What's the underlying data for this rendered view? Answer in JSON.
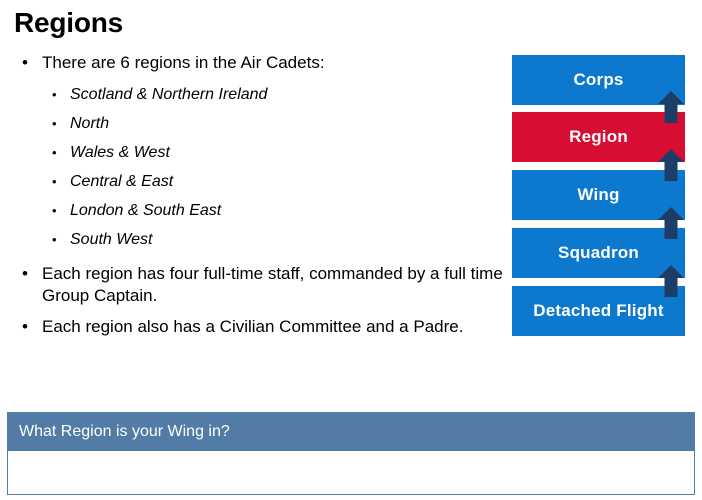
{
  "slide": {
    "title": "Regions"
  },
  "content": {
    "bullets": [
      {
        "text": "There are 6 regions in the Air Cadets:",
        "marker": "•",
        "sub_marker": "•",
        "sub_items": [
          "Scotland & Northern Ireland",
          "North",
          "Wales & West",
          "Central & East",
          "London & South East",
          "South West"
        ]
      },
      {
        "text": "Each region has four full-time staff, commanded by a full time Group Captain.",
        "marker": "•",
        "sub_items": []
      },
      {
        "text": "Each region also has a Civilian Committee and a Padre.",
        "marker": "•",
        "sub_items": []
      }
    ]
  },
  "hierarchy": {
    "name": "air-cadets-structure",
    "blocks": [
      {
        "label": "Corps",
        "color": "#0C78CE",
        "style": "blue"
      },
      {
        "label": "Region",
        "color": "#D80D34",
        "style": "red"
      },
      {
        "label": "Wing",
        "color": "#0C78CE",
        "style": "blue"
      },
      {
        "label": "Squadron",
        "color": "#0C78CE",
        "style": "blue"
      },
      {
        "label": "Detached Flight",
        "color": "#0C78CE",
        "style": "blue"
      }
    ],
    "arrows": [
      {
        "name": "arrow-squadron-to-wing"
      },
      {
        "name": "arrow-wing-to-region"
      },
      {
        "name": "arrow-region-to-corps"
      },
      {
        "name": "arrow-detached-flight-to-squadron"
      }
    ],
    "arrow_color": "#1C3E66",
    "arrow_icon": "arrow-up-icon"
  },
  "question_panel": {
    "label": "What Region is your Wing in?",
    "answer_value": "",
    "answer_placeholder": "",
    "header_color": "#527CA5",
    "border_color": "#5081AE"
  }
}
